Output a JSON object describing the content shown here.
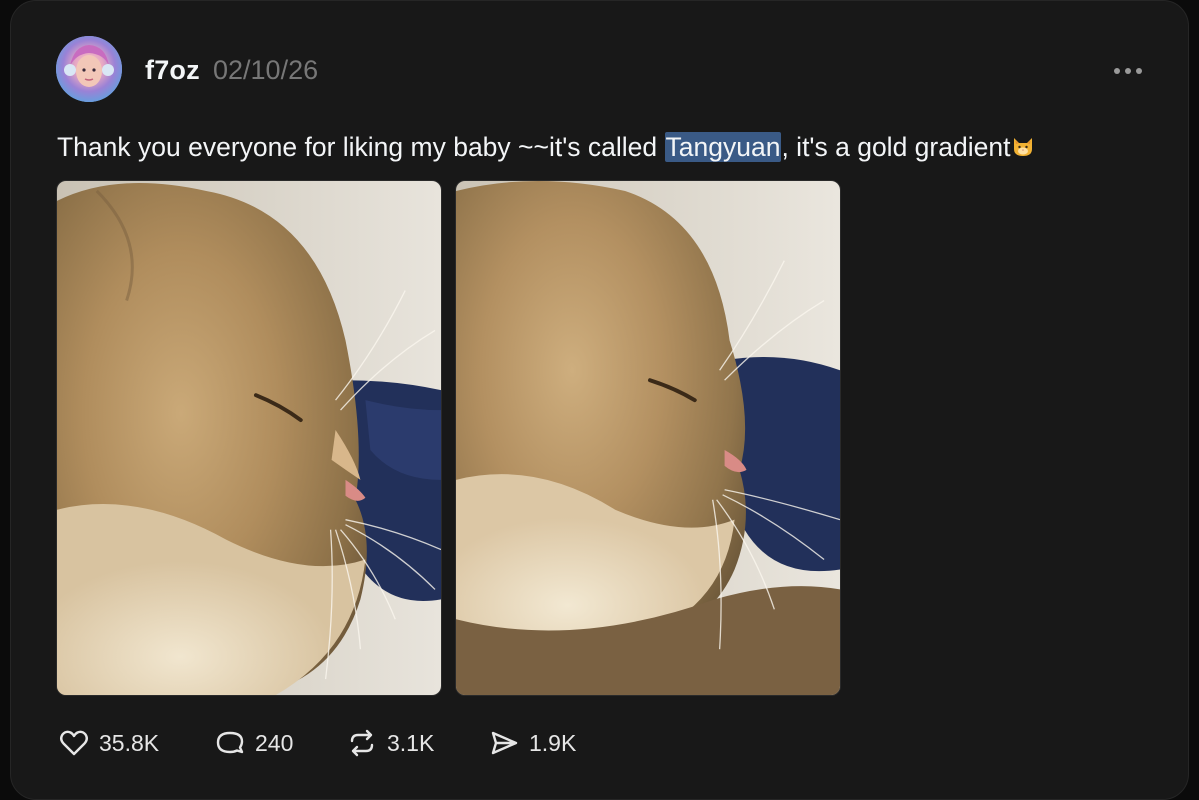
{
  "post": {
    "author": "f7oz",
    "date": "02/10/26",
    "text_before": "Thank you everyone for liking my baby ~~it's called ",
    "text_highlight": "Tangyuan",
    "text_after": ", it's a gold gradient",
    "emoji": "cat-face-emoji",
    "images": [
      {
        "alt_icon": "cat-photo-1"
      },
      {
        "alt_icon": "cat-photo-2"
      }
    ]
  },
  "actions": {
    "likes": "35.8K",
    "replies": "240",
    "reposts": "3.1K",
    "shares": "1.9K"
  },
  "colors": {
    "background": "#181818",
    "text": "#f3f5f7",
    "muted": "#777777",
    "highlight": "#3a5a86"
  }
}
